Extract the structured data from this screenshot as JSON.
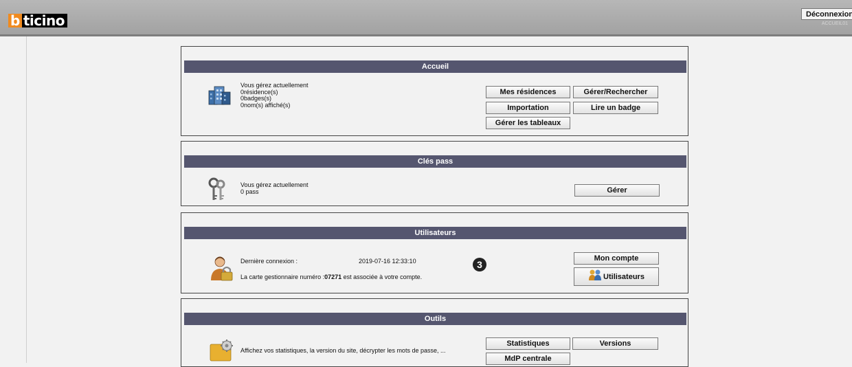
{
  "header": {
    "logo_b": "b",
    "logo_rest": "ticino",
    "logout_label": "Déconnexion",
    "page_code": "ACCUEIL01"
  },
  "accueil": {
    "title": "Accueil",
    "line1": "Vous gérez actuellement",
    "line2": "0résidence(s)",
    "line3": "0badges(s)",
    "line4": "0nom(s) affiché(s)",
    "buttons": {
      "mes_residences": "Mes résidences",
      "gerer_rechercher": "Gérer/Rechercher",
      "importation": "Importation",
      "lire_badge": "Lire un badge",
      "gerer_tableaux": "Gérer les tableaux"
    }
  },
  "cles": {
    "title": "Clés pass",
    "line1": "Vous gérez actuellement",
    "line2": "0 pass",
    "gerer": "Gérer"
  },
  "utilisateurs": {
    "title": "Utilisateurs",
    "last_conn_label": "Dernière connexion :",
    "last_conn_value": "2019-07-16 12:33:10",
    "card_prefix": "La carte gestionnaire numéro :",
    "card_number": "07271",
    "card_suffix": " est associée à votre compte.",
    "callout": "3",
    "mon_compte": "Mon compte",
    "utilisateurs_btn": "Utilisateurs"
  },
  "outils": {
    "title": "Outils",
    "text": "Affichez vos statistiques, la version du site, décrypter les mots de passe, ...",
    "statistiques": "Statistiques",
    "versions": "Versions",
    "mdp_centrale": "MdP centrale"
  },
  "colors": {
    "section_bar": "#55566f",
    "logo_orange": "#f08a1e",
    "header_gray": "#a2a2a2"
  }
}
